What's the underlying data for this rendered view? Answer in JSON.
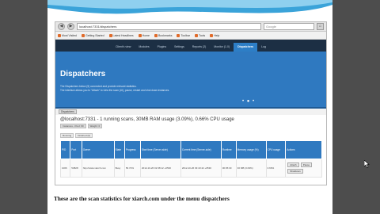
{
  "browser": {
    "address": "localhost:7331/dispatchers",
    "search_placeholder": "Google",
    "bookmarks": [
      "Most Visited",
      "Getting Started",
      "Latest Headlines",
      "Home",
      "Bookmarks",
      "Toolbar",
      "Tools",
      "Help"
    ]
  },
  "app_nav": {
    "tabs": [
      "Client's view",
      "Modules",
      "Plugins",
      "Settings",
      "Reports (2)",
      "Monitor (1.0)",
      "Dispatchers",
      "Log"
    ],
    "active": "Dispatchers"
  },
  "hero": {
    "title": "Dispatchers",
    "line1": "The Dispatchers below (5) connected and provide relevant statistics.",
    "line2": "The interface allows you to \"Attach\" to view the scan (UI), pause, restart and shut down instances."
  },
  "subbar": {
    "chip": "Dispatchers"
  },
  "instance": {
    "summary": "@localhost:7331 - 1 running scans, 30MB RAM usage (3.09%), 0.66% CPU usage",
    "tags": [
      "Instances - Pool: 60",
      "Weight: 0"
    ]
  },
  "filters": [
    "Running",
    "Finished (0)"
  ],
  "table": {
    "headers": [
      "PID",
      "Port",
      "Owner",
      "State",
      "Progress",
      "Start time (Server-side)",
      "Current time (Server-side)",
      "Runtime",
      "Memory usage (%)",
      "CPU usage",
      "Actions"
    ],
    "rows": [
      [
        "1006",
        "53828",
        "http://www.xiarch.com",
        "Busy",
        "56.72%",
        "2012-10-26 02:38:12 +0530",
        "2012-10-26 03:43:42 +0530",
        "00:05:30",
        "30 MB (3.09%)",
        "0.66%",
        ""
      ]
    ],
    "actions": [
      "Attach",
      "Pause",
      "Shutdown"
    ]
  },
  "caption": "These are the scan statistics for xiarch.com under the menu dispatchers"
}
